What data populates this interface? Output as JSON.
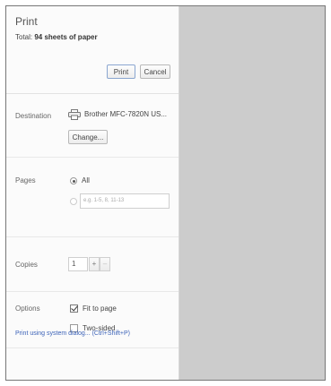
{
  "header": {
    "title": "Print",
    "summary_prefix": "Total: ",
    "summary_value": "94 sheets of paper",
    "print_label": "Print",
    "cancel_label": "Cancel"
  },
  "destination": {
    "label": "Destination",
    "printer_name": "Brother MFC-7820N US...",
    "change_label": "Change..."
  },
  "pages": {
    "label": "Pages",
    "all_label": "All",
    "range_placeholder": "e.g. 1-5, 8, 11-13"
  },
  "copies": {
    "label": "Copies",
    "value": "1",
    "plus_label": "+",
    "minus_label": "–"
  },
  "options": {
    "label": "Options",
    "fit_label": "Fit to page",
    "two_sided_label": "Two-sided"
  },
  "footer": {
    "system_dialog_link": "Print using system dialog... (Ctrl+Shift+P)"
  },
  "colors": {
    "preview_bg": "#cccccc",
    "link": "#3b62b8"
  }
}
